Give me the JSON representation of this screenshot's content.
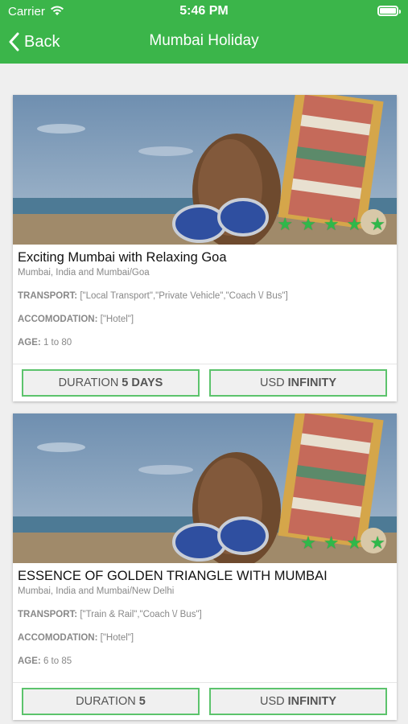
{
  "status_bar": {
    "carrier": "Carrier",
    "time": "5:46 PM"
  },
  "nav": {
    "back_label": "Back",
    "title": "Mumbai Holiday"
  },
  "packages": [
    {
      "title": "Exciting Mumbai with Relaxing Goa",
      "location": "Mumbai, India and Mumbai/Goa",
      "transport_key": "TRANSPORT:",
      "transport_value": "[\"Local Transport\",\"Private Vehicle\",\"Coach \\/ Bus\"]",
      "accommodation_key": "ACCOMODATION:",
      "accommodation_value": "[\"Hotel\"]",
      "age_key": "AGE:",
      "age_value": "1 to 80",
      "rating_stars": 5,
      "duration_label": "DURATION",
      "duration_value": "5 DAYS",
      "price_currency": "USD",
      "price_value": "INFINITY"
    },
    {
      "title": "ESSENCE OF GOLDEN TRIANGLE WITH MUMBAI",
      "location": "Mumbai, India and Mumbai/New Delhi",
      "transport_key": "TRANSPORT:",
      "transport_value": "[\"Train & Rail\",\"Coach \\/ Bus\"]",
      "accommodation_key": "ACCOMODATION:",
      "accommodation_value": "[\"Hotel\"]",
      "age_key": "AGE:",
      "age_value": "6 to 85",
      "rating_stars": 4,
      "duration_label": "DURATION",
      "duration_value": "5",
      "price_currency": "USD",
      "price_value": "INFINITY"
    }
  ],
  "colors": {
    "header_green": "#3bb54a",
    "star_green": "#2fb84a",
    "button_border": "#5cc36c"
  },
  "icons": {
    "back": "chevron-left-icon",
    "wifi": "wifi-icon",
    "battery": "battery-icon",
    "star": "star-icon"
  }
}
